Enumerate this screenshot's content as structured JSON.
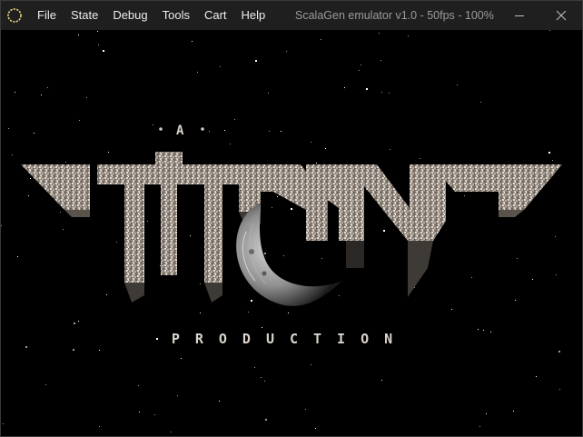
{
  "window": {
    "title": "ScalaGen emulator v1.0 - 50fps - 100%"
  },
  "menu": {
    "items": [
      "File",
      "State",
      "Debug",
      "Tools",
      "Cart",
      "Help"
    ]
  },
  "icons": {
    "app": "circle-app-icon",
    "minimize": "minimize-icon",
    "close": "close-icon"
  },
  "game_screen": {
    "top_text": "A",
    "logo_text": "TITAN",
    "subtitle": "PRODUCTION"
  },
  "colors": {
    "titlebar": "#1f1f1f",
    "screen_bg": "#000000",
    "logo_speckle": "#c8bfb6"
  }
}
